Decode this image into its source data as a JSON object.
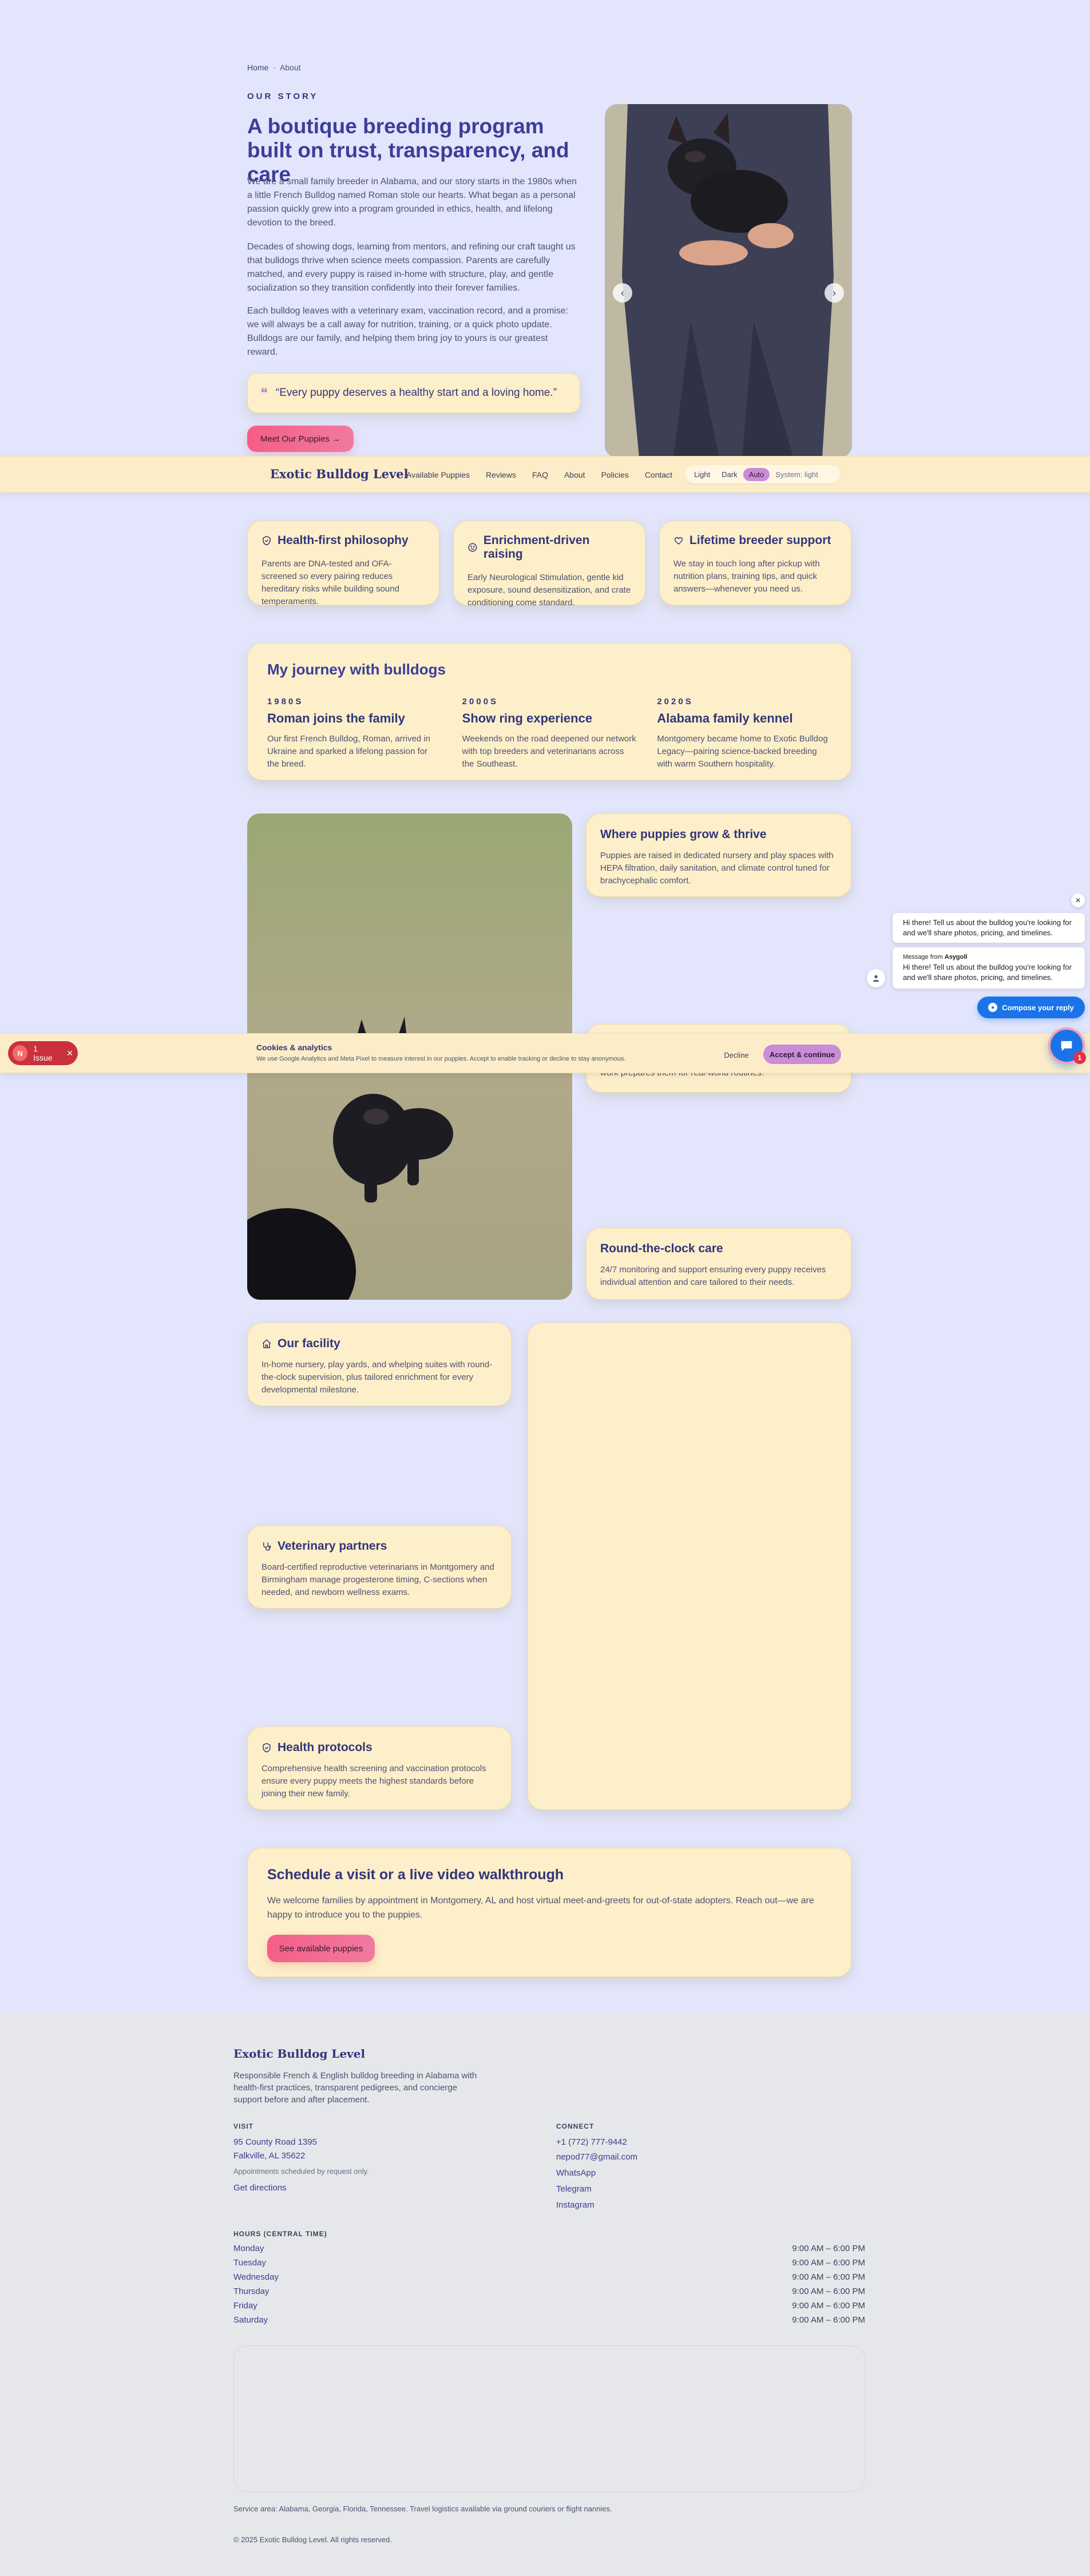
{
  "breadcrumb": {
    "home": "Home",
    "separator": "·",
    "current": "About"
  },
  "hero": {
    "eyebrow": "OUR STORY",
    "title": "A boutique breeding program built on trust, transparency, and care",
    "p1": "We are a small family breeder in Alabama, and our story starts in the 1980s when a little French Bulldog named Roman stole our hearts. What began as a personal passion quickly grew into a program grounded in ethics, health, and lifelong devotion to the breed.",
    "p2": "Decades of showing dogs, learning from mentors, and refining our craft taught us that bulldogs thrive when science meets compassion. Parents are carefully matched, and every puppy is raised in-home with structure, play, and gentle socialization so they transition confidently into their forever families.",
    "p3": "Each bulldog leaves with a veterinary exam, vaccination record, and a promise: we will always be a call away for nutrition, training, or a quick photo update. Bulldogs are our family, and helping them bring joy to yours is our greatest reward.",
    "quote": "“Every puppy deserves a healthy start and a loving home.”",
    "cta": "Meet Our Puppies →"
  },
  "nav": {
    "brand": "Exotic Bulldog Level",
    "links": [
      "Available Puppies",
      "Reviews",
      "FAQ",
      "About",
      "Policies",
      "Contact"
    ],
    "theme_options": [
      "Light",
      "Dark",
      "Auto"
    ],
    "theme_selected": "Auto",
    "theme_status": "System: light"
  },
  "pillars": [
    {
      "icon": "shield-icon",
      "title": "Health-first philosophy",
      "text": "Parents are DNA-tested and OFA-screened so every pairing reduces hereditary risks while building sound temperaments."
    },
    {
      "icon": "smile-icon",
      "title": "Enrichment-driven raising",
      "text": "Early Neurological Stimulation, gentle kid exposure, sound desensitization, and crate conditioning come standard."
    },
    {
      "icon": "heart-icon",
      "title": "Lifetime breeder support",
      "text": "We stay in touch long after pickup with nutrition plans, training tips, and quick answers—whenever you need us."
    }
  ],
  "journey": {
    "title": "My journey with bulldogs",
    "items": [
      {
        "era": "1980S",
        "title": "Roman joins the family",
        "text": "Our first French Bulldog, Roman, arrived in Ukraine and sparked a lifelong passion for the breed."
      },
      {
        "era": "2000S",
        "title": "Show ring experience",
        "text": "Weekends on the road deepened our network with top breeders and veterinarians across the Southeast."
      },
      {
        "era": "2020S",
        "title": "Alabama family kennel",
        "text": "Montgomery became home to Exotic Bulldog Legacy—pairing science-backed breeding with warm Southern hospitality."
      }
    ]
  },
  "features": {
    "top": {
      "title": "Where puppies grow & thrive",
      "text": "Puppies are raised in dedicated nursery and play spaces with HEPA filtration, daily sanitation, and climate control tuned for brachycephalic comfort."
    },
    "middle_partial": "work prepares them for real-world routines.",
    "bottom": {
      "title": "Round-the-clock care",
      "text": "24/7 monitoring and support ensuring every puppy receives individual attention and care tailored to their needs."
    }
  },
  "facility": [
    {
      "icon": "home-icon",
      "title": "Our facility",
      "text": "In-home nursery, play yards, and whelping suites with round-the-clock supervision, plus tailored enrichment for every developmental milestone."
    },
    {
      "icon": "stethoscope-icon",
      "title": "Veterinary partners",
      "text": "Board-certified reproductive veterinarians in Montgomery and Birmingham manage progesterone timing, C-sections when needed, and newborn wellness exams."
    },
    {
      "icon": "shield-icon",
      "title": "Health protocols",
      "text": "Comprehensive health screening and vaccination protocols ensure every puppy meets the highest standards before joining their new family."
    }
  ],
  "schedule": {
    "title": "Schedule a visit or a live video walkthrough",
    "text": "We welcome families by appointment in Montgomery, AL and host virtual meet-and-greets for out-of-state adopters. Reach out—we are happy to introduce you to the puppies.",
    "cta": "See available puppies"
  },
  "cookie": {
    "issue_badge": "N",
    "issue_label": "1 Issue",
    "title": "Cookies & analytics",
    "text": "We use Google Analytics and Meta Pixel to measure interest in our puppies. Accept to enable tracking or decline to stay anonymous.",
    "decline": "Decline",
    "accept": "Accept & continue"
  },
  "chat": {
    "bubble1": "Hi there! Tell us about the bulldog you're looking for and we'll share photos, pricing, and timelines.",
    "from_prefix": "Message from ",
    "from_name": "Asygoll",
    "bubble2": "Hi there! Tell us about the bulldog you're looking for and we'll share photos, pricing, and timelines.",
    "compose": "Compose your reply",
    "badge_count": "1"
  },
  "footer": {
    "brand": "Exotic Bulldog Level",
    "tagline": "Responsible French & English bulldog breeding in Alabama with health-first practices, transparent pedigrees, and concierge support before and after placement.",
    "visit_heading": "VISIT",
    "address1": "95 County Road 1395",
    "address2": "Falkville, AL 35622",
    "appointments": "Appointments scheduled by request only.",
    "directions": "Get directions",
    "connect_heading": "CONNECT",
    "phone": "+1 (772) 777-9442",
    "email": "nepod77@gmail.com",
    "social": [
      "WhatsApp",
      "Telegram",
      "Instagram"
    ],
    "hours_heading": "HOURS (CENTRAL TIME)",
    "hours": [
      {
        "day": "Monday",
        "time": "9:00 AM – 6:00 PM"
      },
      {
        "day": "Tuesday",
        "time": "9:00 AM – 6:00 PM"
      },
      {
        "day": "Wednesday",
        "time": "9:00 AM – 6:00 PM"
      },
      {
        "day": "Thursday",
        "time": "9:00 AM – 6:00 PM"
      },
      {
        "day": "Friday",
        "time": "9:00 AM – 6:00 PM"
      },
      {
        "day": "Saturday",
        "time": "9:00 AM – 6:00 PM"
      }
    ],
    "service_area": "Service area: Alabama, Georgia, Florida, Tennessee. Travel logistics available via ground couriers or flight nannies.",
    "copyright": "© 2025 Exotic Bulldog Level. All rights reserved."
  },
  "colors": {
    "page_bg": "#e2e5fb",
    "card_bg": "#fdefc9",
    "navy": "#33357a",
    "pink": "#f45e86",
    "accept": "#c98cd6",
    "chat_blue": "#1a73e8",
    "footer_bg": "#e6e7ea"
  }
}
